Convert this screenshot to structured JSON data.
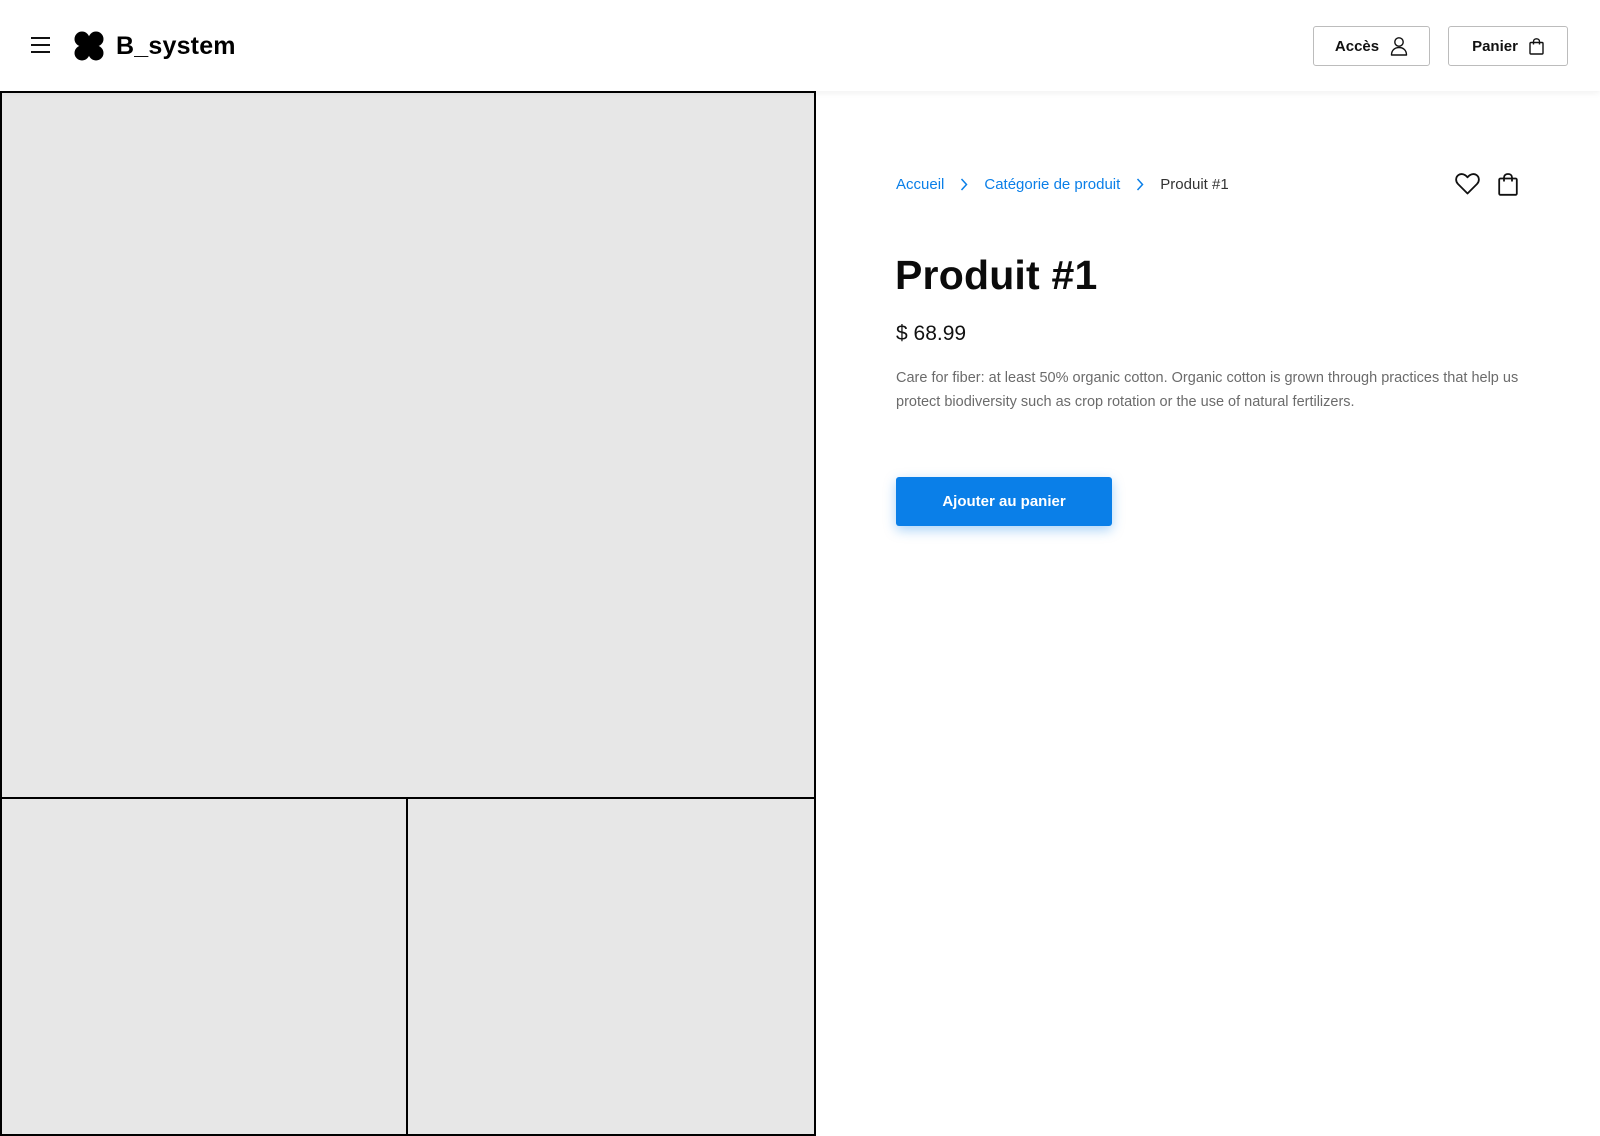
{
  "header": {
    "brand": "B_system",
    "access_label": "Accès",
    "cart_label": "Panier"
  },
  "breadcrumb": {
    "items": [
      "Accueil",
      "Catégorie de produit"
    ],
    "current": "Produit #1"
  },
  "product": {
    "title": "Produit #1",
    "price": "$ 68.99",
    "description": "Care for fiber: at least 50% organic cotton. Organic cotton is grown through practices that help us protect biodiversity such as crop rotation or the use of natural fertilizers.",
    "add_to_cart_label": "Ajouter au panier"
  },
  "icons": {
    "menu": "hamburger-menu-icon",
    "logo": "four-petal-logo-icon",
    "access": "user-icon",
    "cart": "shopping-bag-icon",
    "breadcrumb_separator": "chevron-right-icon",
    "favorite": "heart-icon",
    "bag": "shopping-bag-icon"
  },
  "colors": {
    "accent": "#0a7fe8",
    "image_placeholder": "#e7e7e7",
    "text_muted": "#6b6b6b"
  }
}
